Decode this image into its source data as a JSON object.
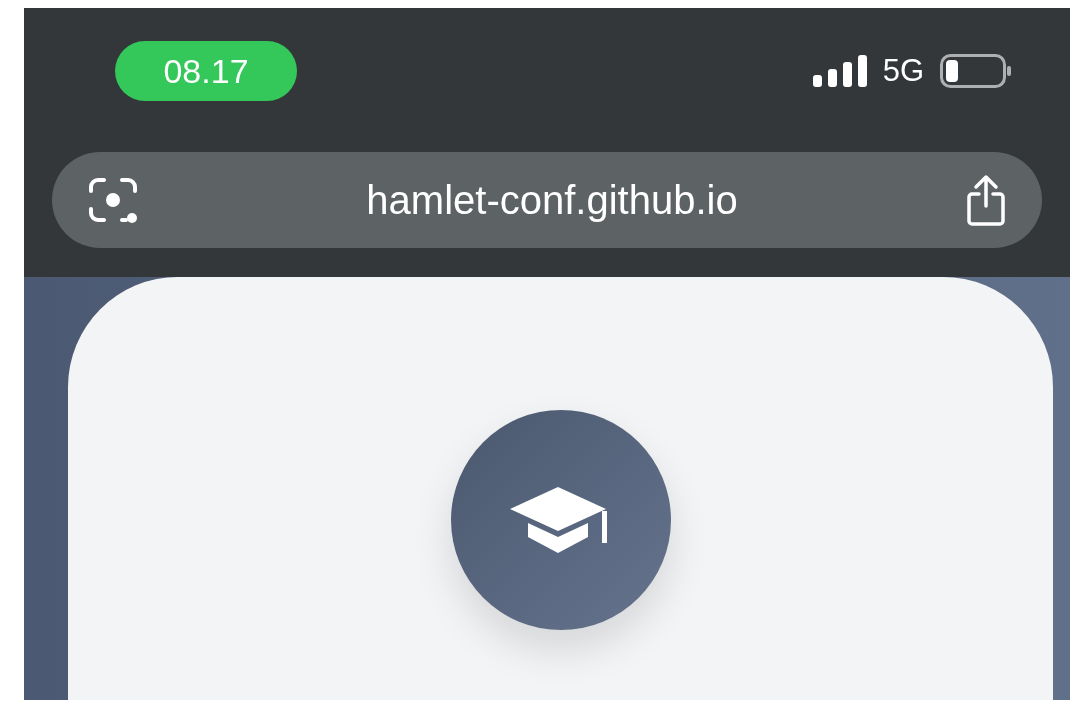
{
  "status_bar": {
    "time": "08.17",
    "network": "5G"
  },
  "address_bar": {
    "url": "hamlet-conf.github.io"
  }
}
